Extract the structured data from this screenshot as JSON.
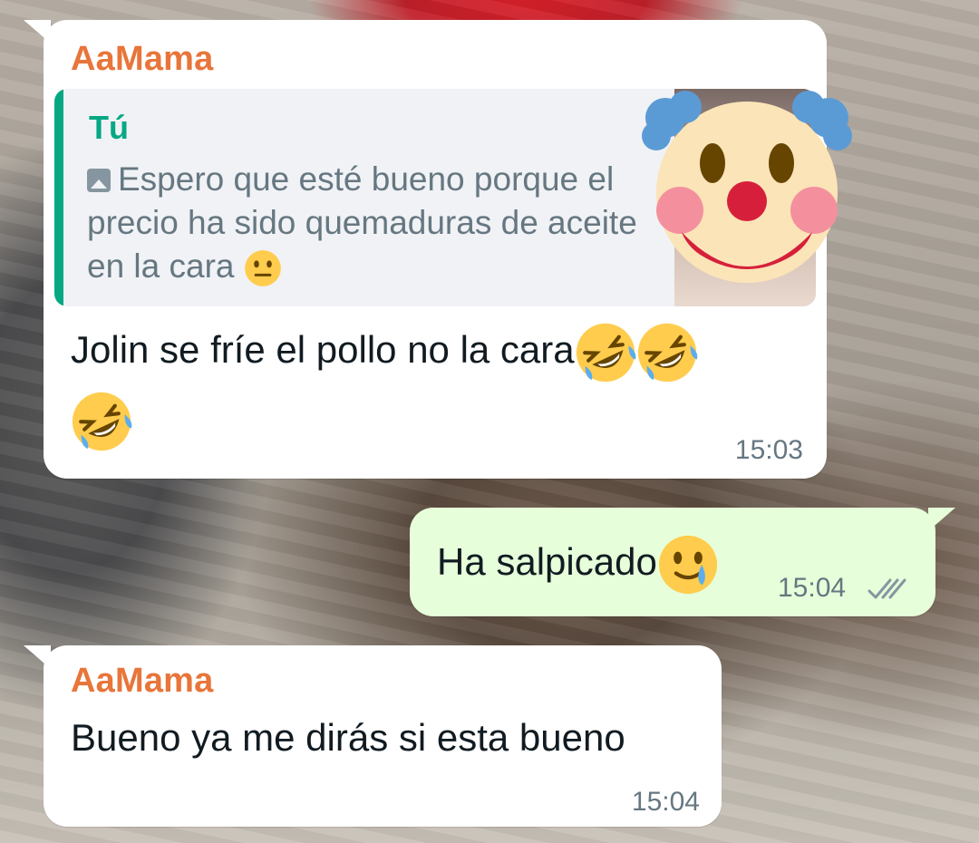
{
  "messages": [
    {
      "sender": "AaMama",
      "quote": {
        "author": "Tú",
        "text": "Espero que esté bueno porque el precio ha sido quemaduras de aceite en la cara"
      },
      "text": "Jolin se fríe el pollo no la cara",
      "time": "15:03"
    },
    {
      "text": "Ha salpicado",
      "time": "15:04",
      "status_icon": "double-check-icon"
    },
    {
      "sender": "AaMama",
      "text": "Bueno ya me dirás si esta bueno",
      "time": "15:04"
    }
  ],
  "colors": {
    "sender": "#e8753a",
    "quote_author": "#06a884",
    "incoming_bubble": "#ffffff",
    "outgoing_bubble": "#e6ffda",
    "meta": "#667781"
  }
}
